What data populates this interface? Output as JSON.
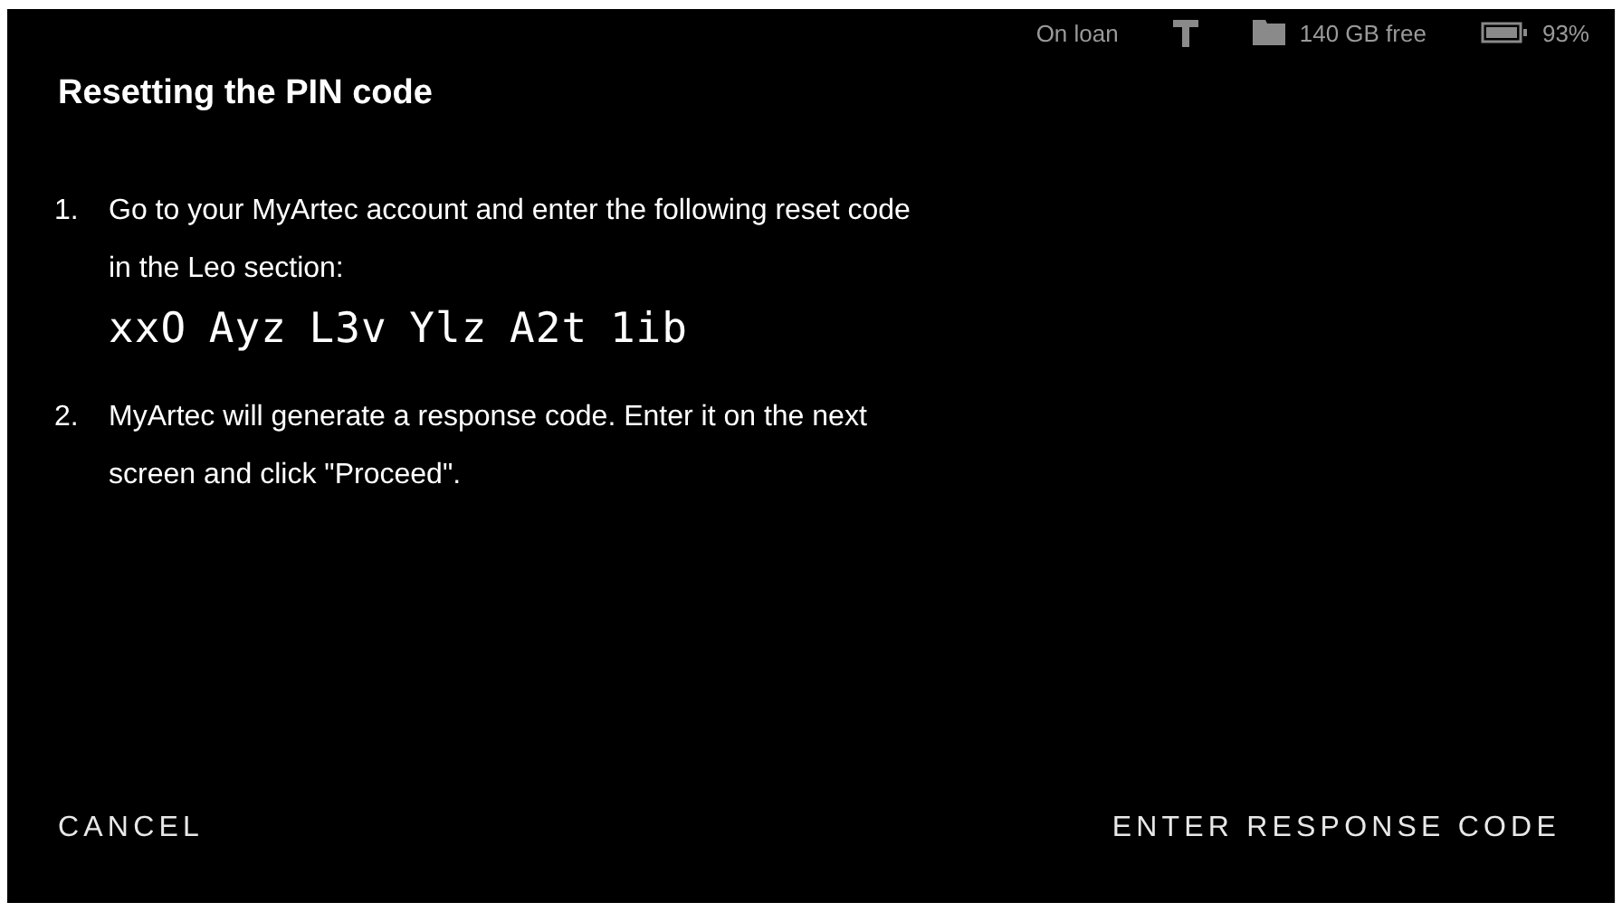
{
  "status_bar": {
    "loan": "On loan",
    "storage": "140 GB free",
    "battery": "93%"
  },
  "title": "Resetting the PIN code",
  "steps": [
    {
      "number": "1.",
      "text": "Go to your MyArtec account and enter the following reset code in the Leo section:",
      "code": "xxO Ayz L3v Ylz A2t 1ib"
    },
    {
      "number": "2.",
      "text": "MyArtec will generate a response code. Enter it on the next screen and click \"Proceed\"."
    }
  ],
  "buttons": [
    "CANCEL",
    "ENTER RESPONSE CODE"
  ]
}
